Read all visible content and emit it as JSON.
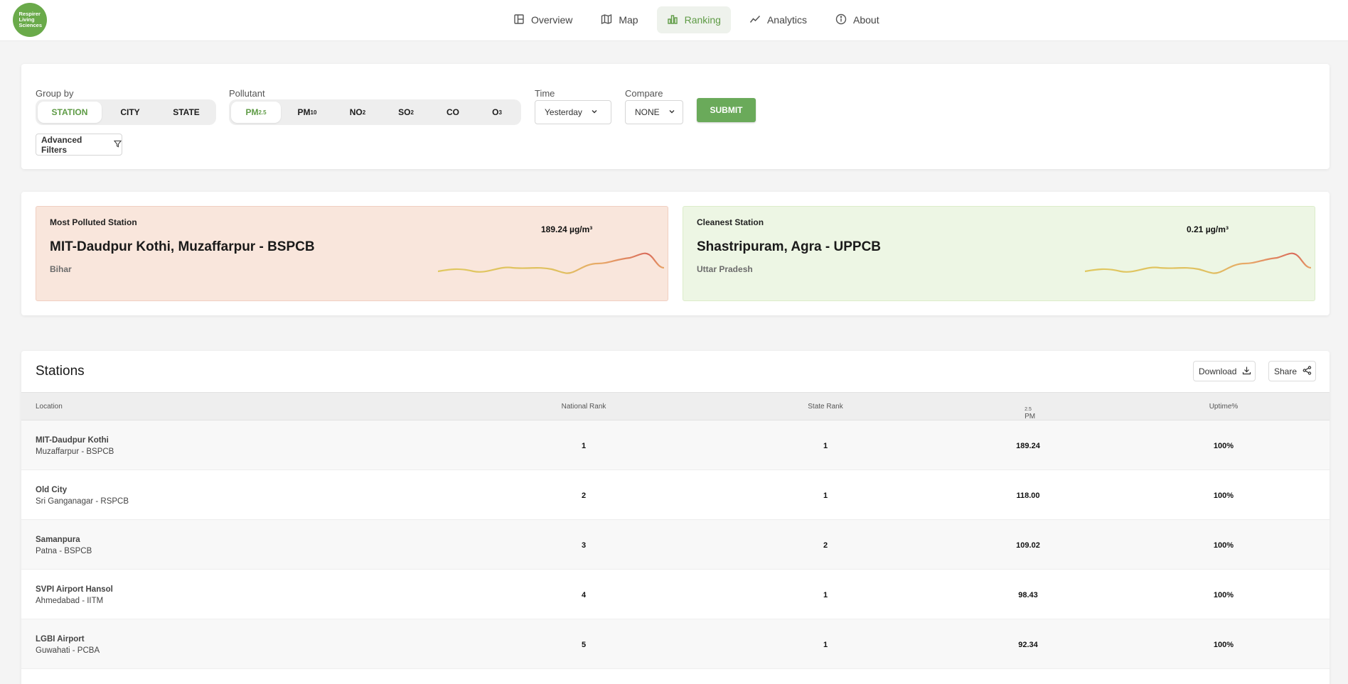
{
  "logo": {
    "text": "Respirer Living Sciences"
  },
  "nav": [
    {
      "label": "Overview",
      "icon": "layout-icon"
    },
    {
      "label": "Map",
      "icon": "map-icon"
    },
    {
      "label": "Ranking",
      "icon": "bar-chart-icon",
      "active": true
    },
    {
      "label": "Analytics",
      "icon": "trend-line-icon"
    },
    {
      "label": "About",
      "icon": "info-icon"
    }
  ],
  "filters": {
    "group_by_label": "Group by",
    "group_by_options": [
      "STATION",
      "CITY",
      "STATE"
    ],
    "group_by_selected": "STATION",
    "pollutant_label": "Pollutant",
    "pollutants": [
      {
        "base": "PM",
        "sub": "2.5"
      },
      {
        "base": "PM",
        "sub": "10"
      },
      {
        "base": "NO",
        "sub": "2"
      },
      {
        "base": "SO",
        "sub": "2"
      },
      {
        "base": "CO",
        "sub": ""
      },
      {
        "base": "O",
        "sub": "3"
      }
    ],
    "pollutant_selected": "PM2.5",
    "time_label": "Time",
    "time_value": "Yesterday",
    "compare_label": "Compare",
    "compare_value": "NONE",
    "submit_label": "SUBMIT",
    "advanced_label": "Advanced Filters"
  },
  "highlights": {
    "polluted": {
      "label": "Most Polluted Station",
      "name": "MIT-Daudpur Kothi, Muzaffarpur - BSPCB",
      "state": "Bihar",
      "value": "189.24 µg/m³"
    },
    "clean": {
      "label": "Cleanest Station",
      "name": "Shastripuram, Agra - UPPCB",
      "state": "Uttar Pradesh",
      "value": "0.21 µg/m³"
    },
    "colors": {
      "polluted_bg": "#f9e6dc",
      "clean_bg": "#edf6e4",
      "spark_yellow": "#e0c860",
      "spark_red": "#d96a5a"
    }
  },
  "stations": {
    "title": "Stations",
    "download_label": "Download",
    "share_label": "Share",
    "columns": [
      "Location",
      "National Rank",
      "State Rank",
      "PM2.5",
      "Uptime%"
    ],
    "pm_col": {
      "base": "PM",
      "sub": "2.5"
    },
    "rows": [
      {
        "name": "MIT-Daudpur Kothi",
        "sub": "Muzaffarpur - BSPCB",
        "national_rank": "1",
        "state_rank": "1",
        "value": "189.24",
        "uptime": "100%"
      },
      {
        "name": "Old City",
        "sub": "Sri Ganganagar - RSPCB",
        "national_rank": "2",
        "state_rank": "1",
        "value": "118.00",
        "uptime": "100%"
      },
      {
        "name": "Samanpura",
        "sub": "Patna - BSPCB",
        "national_rank": "3",
        "state_rank": "2",
        "value": "109.02",
        "uptime": "100%"
      },
      {
        "name": "SVPI Airport Hansol",
        "sub": "Ahmedabad - IITM",
        "national_rank": "4",
        "state_rank": "1",
        "value": "98.43",
        "uptime": "100%"
      },
      {
        "name": "LGBI Airport",
        "sub": "Guwahati - PCBA",
        "national_rank": "5",
        "state_rank": "1",
        "value": "92.34",
        "uptime": "100%"
      }
    ]
  },
  "accent": "#5e9b45"
}
